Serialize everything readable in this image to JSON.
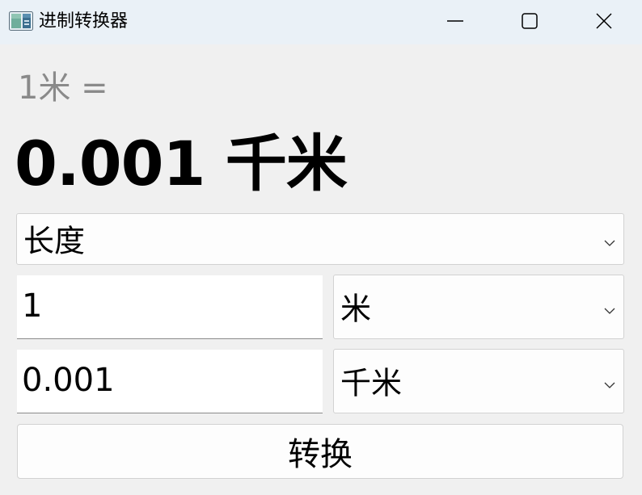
{
  "window": {
    "title": "进制转换器",
    "icons": {
      "app": "converter-app-icon",
      "minimize": "minimize-icon",
      "maximize": "maximize-icon",
      "close": "close-icon"
    }
  },
  "display": {
    "expression": "1米 =",
    "result": "0.001 千米"
  },
  "category": {
    "selected": "长度",
    "icon": "chevron-down-icon"
  },
  "from": {
    "value": "1",
    "unit": "米"
  },
  "to": {
    "value": "0.001",
    "unit": "千米"
  },
  "actions": {
    "convert_label": "转换"
  },
  "colors": {
    "titlebar_bg": "#eaf1f7",
    "window_bg": "#f0f0f0",
    "muted_text": "#8a8a8a"
  }
}
